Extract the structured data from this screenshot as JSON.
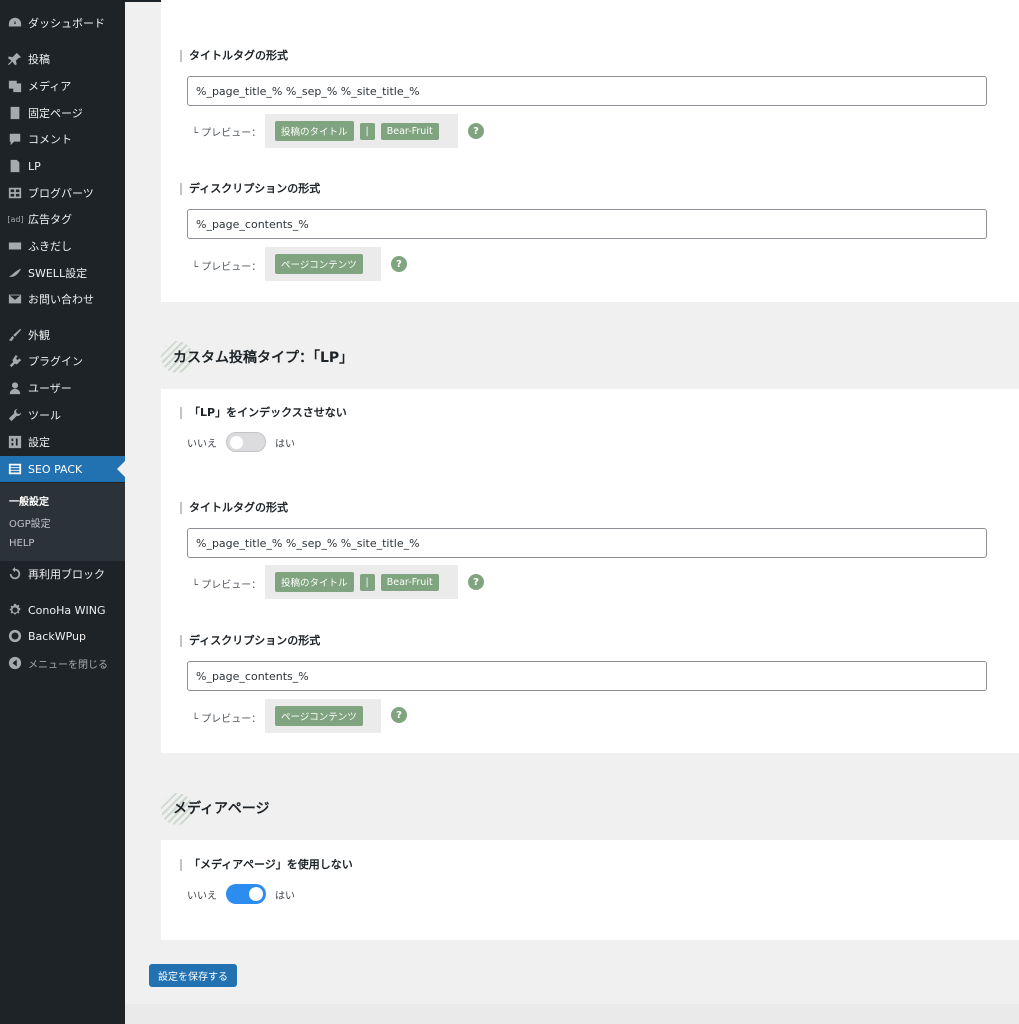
{
  "sidebar": {
    "items": [
      {
        "label": "ダッシュボード",
        "icon": "dashboard-icon"
      },
      {
        "label": "投稿",
        "icon": "pin-icon"
      },
      {
        "label": "メディア",
        "icon": "media-icon"
      },
      {
        "label": "固定ページ",
        "icon": "page-icon"
      },
      {
        "label": "コメント",
        "icon": "comment-icon"
      },
      {
        "label": "LP",
        "icon": "page-icon"
      },
      {
        "label": "ブログパーツ",
        "icon": "grid-icon"
      },
      {
        "label": "広告タグ",
        "icon": "ad-icon",
        "glyph": "[ad]"
      },
      {
        "label": "ふきだし",
        "icon": "bubble-icon"
      },
      {
        "label": "SWELL設定",
        "icon": "swell-icon"
      },
      {
        "label": "お問い合わせ",
        "icon": "mail-icon"
      },
      {
        "label": "外観",
        "icon": "brush-icon"
      },
      {
        "label": "プラグイン",
        "icon": "plugin-icon"
      },
      {
        "label": "ユーザー",
        "icon": "user-icon"
      },
      {
        "label": "ツール",
        "icon": "wrench-icon"
      },
      {
        "label": "設定",
        "icon": "settings-icon"
      },
      {
        "label": "SEO PACK",
        "icon": "list-icon"
      },
      {
        "label": "再利用ブロック",
        "icon": "reuse-icon"
      },
      {
        "label": "ConoHa WING",
        "icon": "gear-icon"
      },
      {
        "label": "BackWPup",
        "icon": "backwpup-icon"
      },
      {
        "label": "メニューを閉じる",
        "icon": "collapse-icon"
      }
    ],
    "submenu": [
      "一般設定",
      "OGP設定",
      "HELP"
    ]
  },
  "post_section": {
    "title_format_label": "タイトルタグの形式",
    "title_format_value": "%_page_title_% %_sep_% %_site_title_%",
    "preview_label": "└ プレビュー：",
    "title_preview_chips": [
      "投稿のタイトル",
      "|",
      "Bear-Fruit"
    ],
    "desc_format_label": "ディスクリプションの形式",
    "desc_format_value": "%_page_contents_%",
    "desc_preview_chips": [
      "ページコンテンツ"
    ],
    "help_glyph": "?"
  },
  "lp_section": {
    "heading": "カスタム投稿タイプ：「LP」",
    "noindex_label": "「LP」をインデックスさせない",
    "toggle_no": "いいえ",
    "toggle_yes": "はい",
    "noindex_on": false,
    "title_format_label": "タイトルタグの形式",
    "title_format_value": "%_page_title_% %_sep_% %_site_title_%",
    "preview_label": "└ プレビュー：",
    "title_preview_chips": [
      "投稿のタイトル",
      "|",
      "Bear-Fruit"
    ],
    "desc_format_label": "ディスクリプションの形式",
    "desc_format_value": "%_page_contents_%",
    "desc_preview_chips": [
      "ページコンテンツ"
    ]
  },
  "media_section": {
    "heading": "メディアページ",
    "disable_label": "「メディアページ」を使用しない",
    "toggle_no": "いいえ",
    "toggle_yes": "はい",
    "disable_on": true
  },
  "save_button": "設定を保存する",
  "colors": {
    "accent": "#2271b1",
    "chip": "#7fa47f",
    "sidebar": "#1d2327",
    "toggle_on": "#2c8cf0"
  }
}
